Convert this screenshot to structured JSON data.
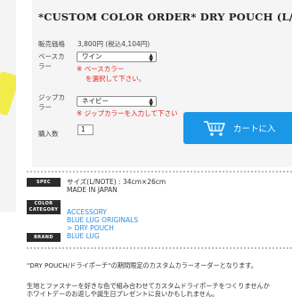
{
  "product": {
    "title": "*CUSTOM COLOR ORDER* DRY POUCH (L/NO",
    "price_label": "販売価格",
    "price_value": "3,800円 (税込4,104円)"
  },
  "options": {
    "base_color": {
      "label_line1": "ベースカ",
      "label_line2": "ラー",
      "selected": "ワイン",
      "error_line1": "※ ベースカラー",
      "error_line2": "を選択して下さい。"
    },
    "zipper_color": {
      "label_line1": "ジップカ",
      "label_line2": "ラー",
      "selected": "ネイビー",
      "error": "※ ジップカラーを入力して下さい"
    },
    "quantity": {
      "label": "購入数",
      "value": "1"
    }
  },
  "cart_button": {
    "label": "カートに入",
    "icon": "shopping-cart-icon"
  },
  "specs": {
    "spec_tag": "SPEC",
    "spec_size": "サイズ(L/NOTE) : 34cm×26cm",
    "spec_origin": "MADE IN JAPAN",
    "category_tag_line1": "COLOR",
    "category_tag_line2": "CATEGORY",
    "category_links": [
      "ACCESSORY",
      "BLUE LUG ORIGINALS",
      "> DRY POUCH"
    ],
    "brand_tag": "BRAND",
    "brand_link": "BLUE LUG"
  },
  "description": {
    "line1": "\"DRY POUCH/ドライポーチ\"の期間限定のカスタムカラーオーダーとなります。",
    "line2": "生地とファスナーを好きな色で組み合わせてカスタムドライポーチをつくりませんか",
    "line3": "ホワイトデーのお返しや誕生日プレゼントに良いかもしれません。"
  },
  "colors": {
    "accent": "#1b97e8",
    "error": "#e8211a",
    "link": "#2a8fe0",
    "tag_bg": "#2b2b2b"
  }
}
